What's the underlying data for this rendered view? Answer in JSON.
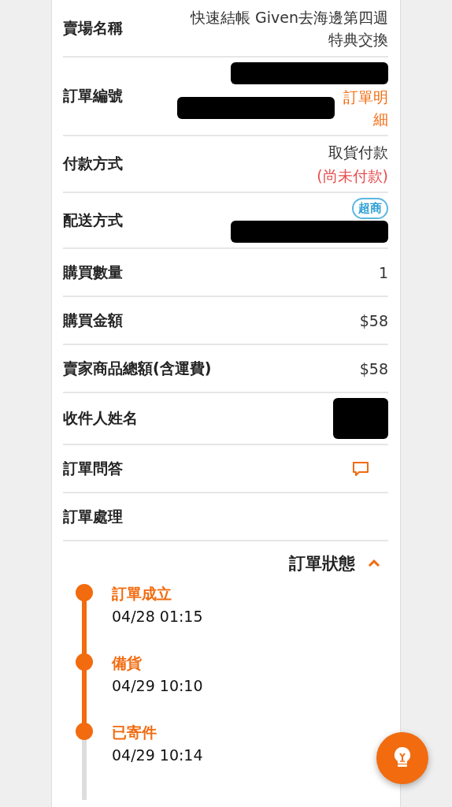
{
  "order_details": [
    {
      "label": "賣場名稱",
      "lines": [
        [
          {
            "kind": "text",
            "text": "快速結帳 Given去海邊第四週特典交換"
          }
        ]
      ]
    },
    {
      "label": "訂單編號",
      "lines": [
        [
          {
            "kind": "redacted"
          }
        ],
        [
          {
            "kind": "redacted"
          },
          {
            "kind": "link",
            "text": "訂單明細"
          }
        ]
      ]
    },
    {
      "label": "付款方式",
      "lines": [
        [
          {
            "kind": "text",
            "text": "取貨付款"
          }
        ],
        [
          {
            "kind": "warning",
            "text": "(尚未付款)"
          }
        ]
      ]
    },
    {
      "label": "配送方式",
      "lines": [
        [
          {
            "kind": "tag",
            "text": "超商"
          }
        ],
        [
          {
            "kind": "redacted"
          }
        ]
      ]
    },
    {
      "label": "購買數量",
      "lines": [
        [
          {
            "kind": "text",
            "text": "1"
          }
        ]
      ]
    },
    {
      "label": "購買金額",
      "lines": [
        [
          {
            "kind": "text",
            "text": "$58"
          }
        ]
      ]
    },
    {
      "label": "賣家商品總額(含運費)",
      "lines": [
        [
          {
            "kind": "text",
            "text": "$58"
          }
        ]
      ]
    },
    {
      "label": "收件人姓名",
      "lines": [
        [
          {
            "kind": "blackout"
          }
        ]
      ]
    },
    {
      "label": "訂單問答",
      "lines": [
        [
          {
            "kind": "chat"
          }
        ]
      ]
    },
    {
      "label": "訂單處理"
    }
  ],
  "order_status": {
    "title": "訂單狀態",
    "expanded": true,
    "steps": [
      {
        "name": "訂單成立",
        "time": "04/28 01:15",
        "reached": true,
        "segment_done": true
      },
      {
        "name": "備貨",
        "time": "04/29 10:10",
        "reached": true,
        "segment_done": true
      },
      {
        "name": "已寄件",
        "time": "04/29 10:14",
        "reached": true,
        "segment_done": false
      }
    ]
  }
}
